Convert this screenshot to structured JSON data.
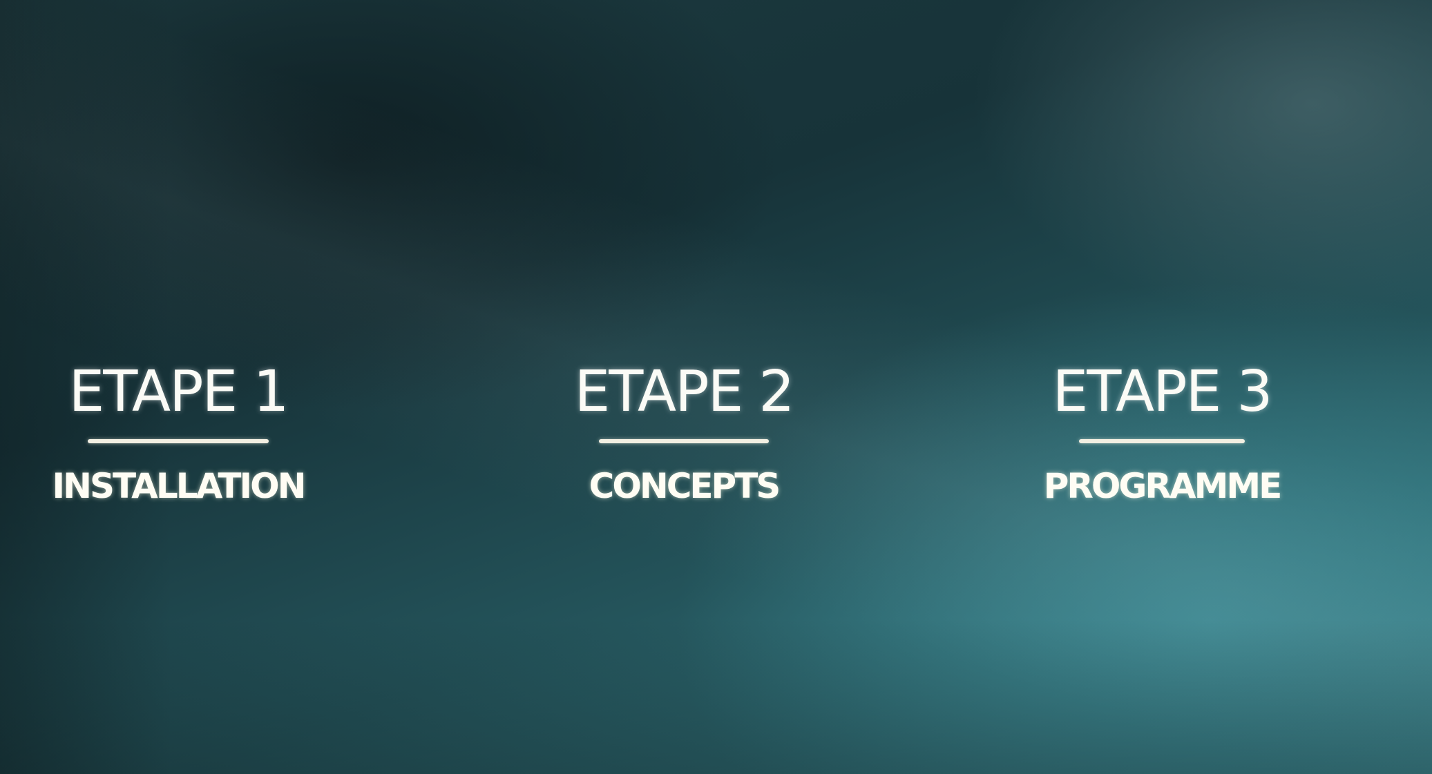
{
  "steps": [
    {
      "title": "ETAPE 1",
      "subtitle": "INSTALLATION"
    },
    {
      "title": "ETAPE 2",
      "subtitle": "CONCEPTS"
    },
    {
      "title": "ETAPE 3",
      "subtitle": "PROGRAMME"
    }
  ],
  "colors": {
    "text": "#fbfbf6",
    "divider": "#f2efe2",
    "background_dark": "#173339",
    "background_light": "#3c8a93"
  }
}
